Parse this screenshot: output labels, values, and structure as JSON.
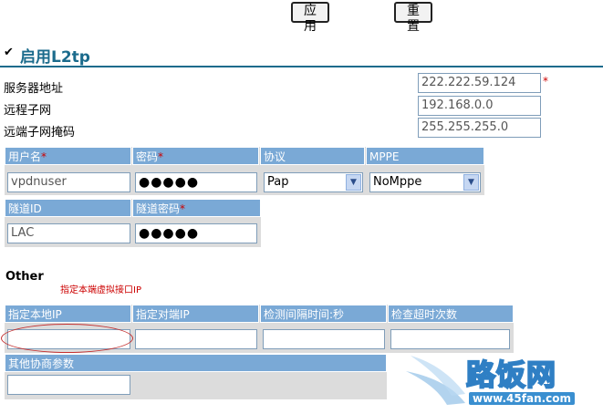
{
  "toolbar": {
    "apply_label": "应用",
    "reset_label": "重置"
  },
  "l2tp": {
    "checkbox_mark": "✔",
    "title": "启用L2tp",
    "server_address_label": "服务器地址",
    "server_address_value": "222.222.59.124",
    "required_mark": "*",
    "remote_subnet_label": "远程子网",
    "remote_subnet_value": "192.168.0.0",
    "remote_mask_label": "远端子网掩码",
    "remote_mask_value": "255.255.255.0"
  },
  "auth_table": {
    "headers": [
      "用户名",
      "密码",
      "协议",
      "MPPE"
    ],
    "username": "vpdnuser",
    "password": "●●●●●",
    "protocol": "Pap",
    "mppe": "NoMppe"
  },
  "tunnel_table": {
    "headers": [
      "隧道ID",
      "隧道密码"
    ],
    "tunnel_id": "LAC",
    "tunnel_password": "●●●●●"
  },
  "other": {
    "title": "Other",
    "annotation": "指定本端虚拟接口IP",
    "headers": [
      "指定本地IP",
      "指定对端IP",
      "检测间隔时间:秒",
      "检查超时次数"
    ],
    "extra_label": "其他协商参数"
  },
  "watermark": {
    "brand": "路饭网",
    "url": "www.45fan.com"
  },
  "colors": {
    "header_blue": "#7aa9d6",
    "title_teal": "#1b6b8c",
    "annotation_red": "#cc0000"
  }
}
